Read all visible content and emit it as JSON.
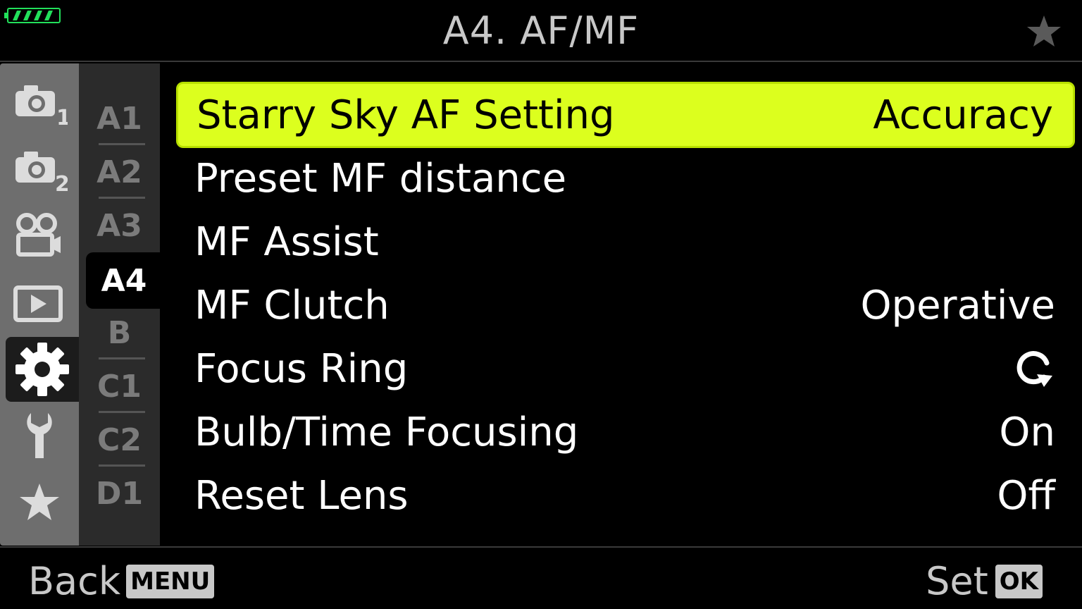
{
  "header": {
    "title": "A4. AF/MF"
  },
  "colors": {
    "highlight": "#dcff1e",
    "battery": "#22e05a",
    "category_bg": "#6e6e6e",
    "subtab_bg": "#2b2b2b"
  },
  "categories": [
    {
      "icon": "camera-1-icon",
      "sub": "1"
    },
    {
      "icon": "camera-2-icon",
      "sub": "2"
    },
    {
      "icon": "movie-camera-icon"
    },
    {
      "icon": "playback-icon"
    },
    {
      "icon": "gear-icon",
      "active": true
    },
    {
      "icon": "wrench-icon"
    },
    {
      "icon": "star-icon"
    }
  ],
  "subtabs": [
    "A1",
    "A2",
    "A3",
    "A4",
    "B",
    "C1",
    "C2",
    "D1"
  ],
  "active_subtab": "A4",
  "menu": [
    {
      "label": "Starry Sky AF Setting",
      "value": "Accuracy",
      "selected": true
    },
    {
      "label": "Preset MF distance",
      "value": ""
    },
    {
      "label": "MF Assist",
      "value": ""
    },
    {
      "label": "MF Clutch",
      "value": "Operative"
    },
    {
      "label": "Focus Ring",
      "value": "",
      "value_icon": "clockwise-arrow-icon"
    },
    {
      "label": "Bulb/Time Focusing",
      "value": "On"
    },
    {
      "label": "Reset Lens",
      "value": "Off"
    }
  ],
  "footer": {
    "back_label": "Back",
    "back_key": "MENU",
    "set_label": "Set",
    "set_key": "OK"
  }
}
